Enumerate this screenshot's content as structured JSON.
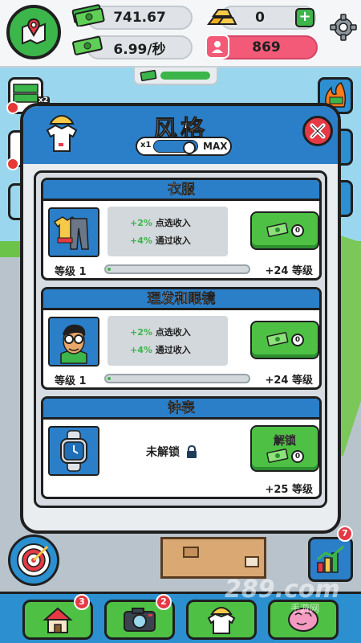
{
  "topbar": {
    "money": "741.67",
    "rate": "6.99/秒",
    "gold": "0",
    "gold_plus": "+",
    "population": "869",
    "boost_progress": 1.0
  },
  "modal": {
    "title": "风格",
    "toggle_min": "x1",
    "toggle_max": "MAX",
    "close": "close"
  },
  "cards": [
    {
      "title": "衣服",
      "stat1_pct": "+2%",
      "stat1_text": "点选收入",
      "stat2_pct": "+4%",
      "stat2_text": "通过收入",
      "price": "0",
      "level_label": "等级 1",
      "level_progress": 0.02,
      "next_level": "+24 等级"
    },
    {
      "title": "理发和眼镜",
      "stat1_pct": "+2%",
      "stat1_text": "点选收入",
      "stat2_pct": "+4%",
      "stat2_text": "通过收入",
      "price": "0",
      "level_label": "等级 1",
      "level_progress": 0.02,
      "next_level": "+24 等级"
    },
    {
      "title": "钟表",
      "locked_text": "未解锁",
      "unlock_label": "解锁",
      "price": "0",
      "next_level": "+25 等级"
    }
  ],
  "side": {
    "video_badge": "x2"
  },
  "bottom_nav": {
    "home_badge": "3",
    "camera_badge": "2",
    "stats_badge": "7"
  },
  "watermark": {
    "main": "289.com",
    "sub": "手游网"
  },
  "colors": {
    "primary_blue": "#2b7fc8",
    "green": "#4ec144",
    "red": "#e53945",
    "pink": "#f25a78"
  }
}
